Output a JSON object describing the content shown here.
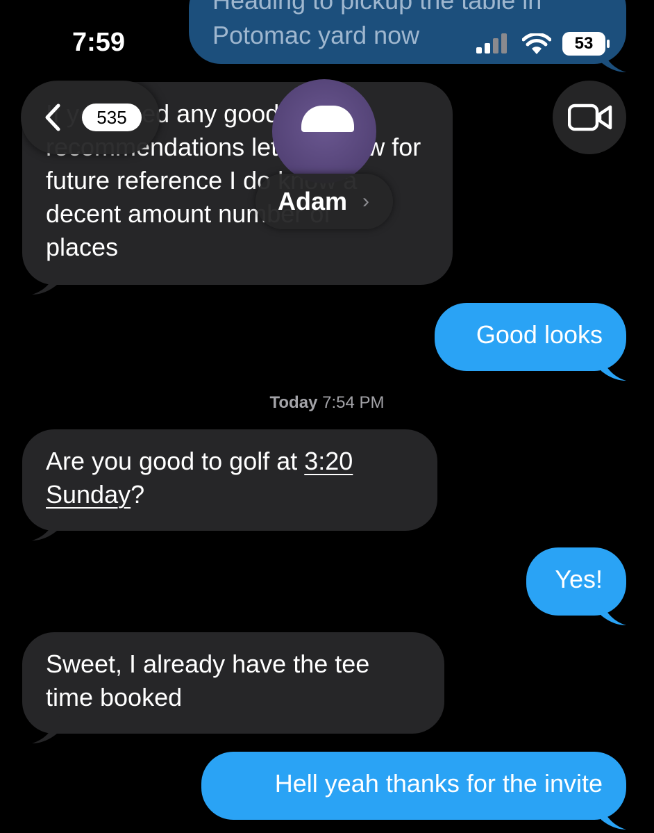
{
  "status": {
    "time": "7:59",
    "battery": "53"
  },
  "nav": {
    "unread_count": "535",
    "contact_name": "Adam"
  },
  "messages": [
    {
      "from": "me",
      "lines": [
        "Heading to pickup the table in",
        "Potomac yard now"
      ]
    },
    {
      "from": "them",
      "lines": [
        "If you need any good place",
        "recommendations let me know for",
        "future reference I do know a",
        "decent amount number of",
        "places"
      ]
    },
    {
      "from": "me",
      "text": "Good looks"
    },
    {
      "from": "them",
      "text_before": "Are you good to golf at ",
      "link_time": "3:20",
      "link_day": "Sunday",
      "text_after": "?"
    },
    {
      "from": "me",
      "text": "Yes!"
    },
    {
      "from": "them",
      "lines": [
        "Sweet, I already have the tee",
        "time booked"
      ]
    },
    {
      "from": "me",
      "text": "Hell yeah thanks for the invite"
    }
  ],
  "timestamp": {
    "day": "Today",
    "time": "7:54 PM"
  },
  "icons": {
    "back": "chevron-left-icon",
    "video": "video-camera-icon",
    "signal": "cellular-signal-icon",
    "wifi": "wifi-icon",
    "battery": "battery-icon"
  },
  "colors": {
    "background": "#000000",
    "incoming_bubble": "#262628",
    "outgoing_bubble": "#2aa3f5",
    "secondary_text": "#a3a3a8"
  }
}
